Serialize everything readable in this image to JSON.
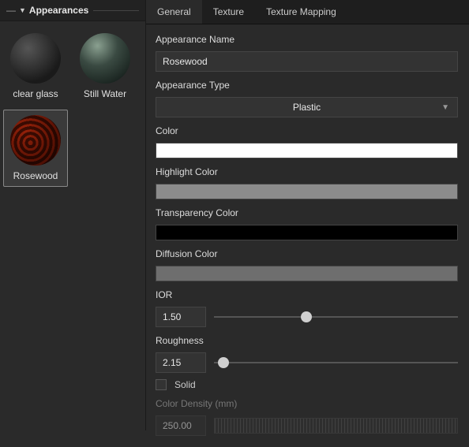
{
  "sidebar": {
    "title": "Appearances",
    "items": [
      {
        "label": "clear glass"
      },
      {
        "label": "Still Water"
      },
      {
        "label": "Rosewood"
      }
    ]
  },
  "tabs": [
    {
      "label": "General"
    },
    {
      "label": "Texture"
    },
    {
      "label": "Texture Mapping"
    }
  ],
  "form": {
    "name_label": "Appearance Name",
    "name_value": "Rosewood",
    "type_label": "Appearance Type",
    "type_value": "Plastic",
    "color_label": "Color",
    "color_value": "#ffffff",
    "highlight_label": "Highlight Color",
    "highlight_value": "#8c8c8c",
    "transparency_label": "Transparency Color",
    "transparency_value": "#000000",
    "diffusion_label": "Diffusion Color",
    "diffusion_value": "#6e6e6e",
    "ior_label": "IOR",
    "ior_value": "1.50",
    "ior_pos": "38%",
    "roughness_label": "Roughness",
    "roughness_value": "2.15",
    "roughness_pos": "4%",
    "solid_label": "Solid",
    "density_label": "Color Density (mm)",
    "density_value": "250.00"
  }
}
